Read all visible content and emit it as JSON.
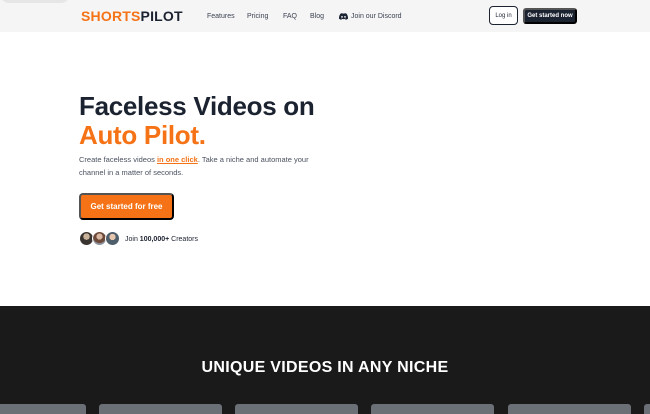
{
  "header": {
    "logo_part1": "SHORTS",
    "logo_part2": "PILOT",
    "nav": [
      {
        "label": "Features"
      },
      {
        "label": "Pricing"
      },
      {
        "label": "FAQ"
      },
      {
        "label": "Blog"
      }
    ],
    "discord_label": "Join our Discord",
    "login_label": "Log in",
    "start_label": "Get started now"
  },
  "hero": {
    "title_line1": "Faceless Videos on",
    "title_line2": "Auto Pilot.",
    "desc_before": "Create faceless videos ",
    "desc_highlight": "in one click",
    "desc_after": ". Take a niche and automate your channel in a matter of seconds.",
    "cta_label": "Get started for free",
    "join_prefix": "Join ",
    "join_count": "100,000+",
    "join_suffix": " Creators"
  },
  "section": {
    "title": "UNIQUE VIDEOS IN ANY NICHE"
  },
  "colors": {
    "accent": "#f57316",
    "dark": "#1b2230",
    "section_bg": "#1a1a1a"
  }
}
